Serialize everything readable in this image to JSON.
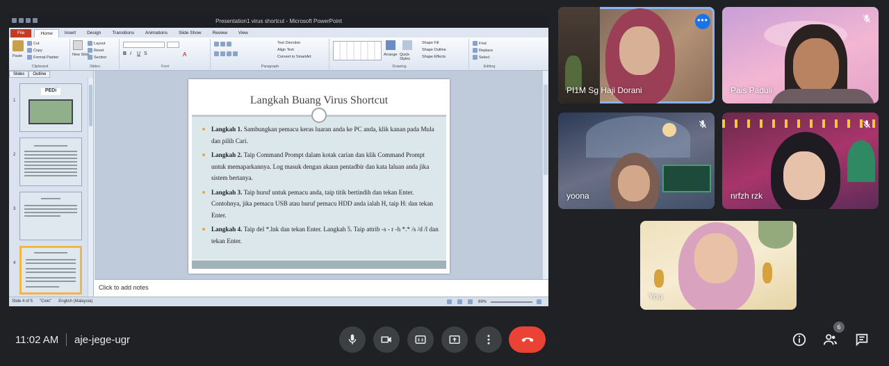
{
  "powerpoint": {
    "window_title": "Presentation1 virus shortcut - Microsoft PowerPoint",
    "tabs": [
      "File",
      "Home",
      "Insert",
      "Design",
      "Transitions",
      "Animations",
      "Slide Show",
      "Review",
      "View"
    ],
    "ribbon": {
      "clipboard": {
        "paste": "Paste",
        "cut": "Cut",
        "copy": "Copy",
        "format_painter": "Format Painter",
        "label": "Clipboard"
      },
      "slides": {
        "new_slide": "New Slide",
        "layout": "Layout",
        "reset": "Reset",
        "section": "Section",
        "label": "Slides"
      },
      "font": {
        "label": "Font"
      },
      "paragraph": {
        "text_direction": "Text Direction",
        "align_text": "Align Text",
        "convert": "Convert to SmartArt",
        "label": "Paragraph"
      },
      "drawing": {
        "arrange": "Arrange",
        "quick_styles": "Quick Styles",
        "shape_fill": "Shape Fill",
        "shape_outline": "Shape Outline",
        "shape_effects": "Shape Effects",
        "label": "Drawing"
      },
      "editing": {
        "find": "Find",
        "replace": "Replace",
        "select": "Select",
        "label": "Editing"
      }
    },
    "panel_tabs": [
      "Slides",
      "Outline"
    ],
    "thumbnails": [
      "1",
      "2",
      "3",
      "4"
    ],
    "thumb1_title": "PEDi",
    "slide": {
      "title": "Langkah Buang Virus Shortcut",
      "bullets": [
        {
          "bold": "Langkah 1.",
          "text": " Sambungkan pemacu keras luaran anda ke PC anda, klik kanan pada Mula dan pilih Cari."
        },
        {
          "bold": "Langkah 2.",
          "text": " Taip Command Prompt dalam kotak carian dan klik Command Prompt untuk memaparkannya. Log masuk dengan akaun pentadbir dan kata laluan anda jika sistem bertanya."
        },
        {
          "bold": "Langkah 3.",
          "text": " Taip huruf untuk pemacu anda, taip titik bertindih dan tekan Enter. Contohnya, jika pemacu USB atau huruf pemacu HDD anda ialah H, taip H: dan tekan Enter."
        },
        {
          "bold": "Langkah 4.",
          "text": " Taip del *.lnk dan tekan Enter. Langkah 5. Taip attrib -s - r -h *.* /s /d /l dan tekan Enter."
        }
      ]
    },
    "notes_placeholder": "Click to add notes",
    "status": {
      "slide": "Slide 4 of 5",
      "theme": "\"Civic\"",
      "language": "English (Malaysia)",
      "zoom": "69%"
    }
  },
  "participants": [
    {
      "name": "PI1M Sg Haji Dorani",
      "active": true
    },
    {
      "name": "Pais Paduli"
    },
    {
      "name": "yoona"
    },
    {
      "name": "nrfzh rzk"
    },
    {
      "name": "You"
    }
  ],
  "meeting": {
    "time": "11:02 AM",
    "code": "aje-jege-ugr",
    "participant_count": "6"
  },
  "controls": [
    "mic-icon",
    "camera-icon",
    "captions-icon",
    "present-icon",
    "more-vert-icon",
    "end-call-icon"
  ],
  "colors": {
    "end_call": "#ea4335",
    "active_speaker": "#8ab4f8",
    "background": "#202124"
  }
}
